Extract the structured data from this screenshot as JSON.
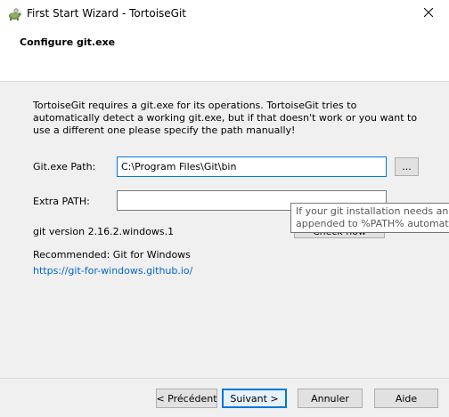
{
  "window": {
    "title": "First Start Wizard - TortoiseGit",
    "app_icon": "tortoise-icon",
    "close_icon": "close-icon"
  },
  "header": {
    "heading": "Configure git.exe"
  },
  "description": "TortoiseGit requires a git.exe for its operations. TortoiseGit tries to automatically detect a working git.exe, but if that doesn't work or you want to use a different one please specify the path manually!",
  "form": {
    "git_path_label": "Git.exe Path:",
    "git_path_value": "C:\\Program Files\\Git\\bin",
    "browse_label": "...",
    "extra_path_label": "Extra PATH:",
    "extra_path_value": "",
    "check_now_label": "Check now"
  },
  "tooltip": {
    "line1": "If your git installation needs an ex",
    "line2": "appended to %PATH% automatic"
  },
  "status": {
    "git_version": "git version 2.16.2.windows.1",
    "recommended": "Recommended: Git for Windows",
    "link": "https://git-for-windows.github.io/"
  },
  "buttons": {
    "back": "< Précédent",
    "next": "Suivant >",
    "cancel": "Annuler",
    "help": "Aide"
  },
  "colors": {
    "accent": "#0078d7",
    "link": "#0066cc"
  }
}
